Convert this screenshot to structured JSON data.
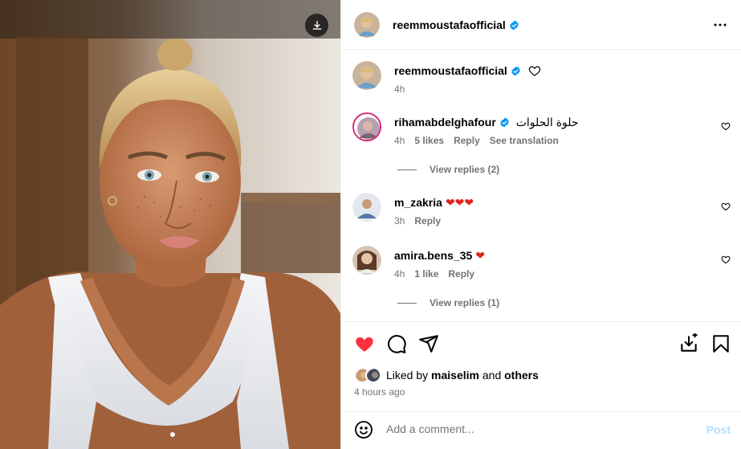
{
  "post": {
    "username": "reemmoustafaofficial",
    "more_icon": "more-horizontal-icon",
    "download_icon": "download-icon"
  },
  "caption": {
    "username": "reemmoustafaofficial",
    "time": "4h"
  },
  "comments": [
    {
      "username": "rihamabdelghafour",
      "verified": true,
      "text": "حلوة الحلوات",
      "time": "4h",
      "likes": "5 likes",
      "reply": "Reply",
      "translate": "See translation",
      "replies": "View replies (2)"
    },
    {
      "username": "m_zakria",
      "verified": false,
      "text": "❤❤❤",
      "time": "3h",
      "reply": "Reply"
    },
    {
      "username": "amira.bens_35",
      "verified": false,
      "text": "❤",
      "time": "4h",
      "likes": "1 like",
      "reply": "Reply",
      "replies": "View replies (1)"
    }
  ],
  "engagement": {
    "liked": true,
    "liked_by_prefix": "Liked by",
    "liked_by_user": "maiselim",
    "liked_by_and": "and",
    "liked_by_others": "others",
    "time_ago": "4 hours ago"
  },
  "composer": {
    "placeholder": "Add a comment...",
    "post_label": "Post",
    "emoji_icon": "smile-icon"
  },
  "colors": {
    "like_red": "#ff3040",
    "verified_blue": "#0095f6",
    "post_disabled": "#b2dffc",
    "meta_gray": "#737373"
  }
}
